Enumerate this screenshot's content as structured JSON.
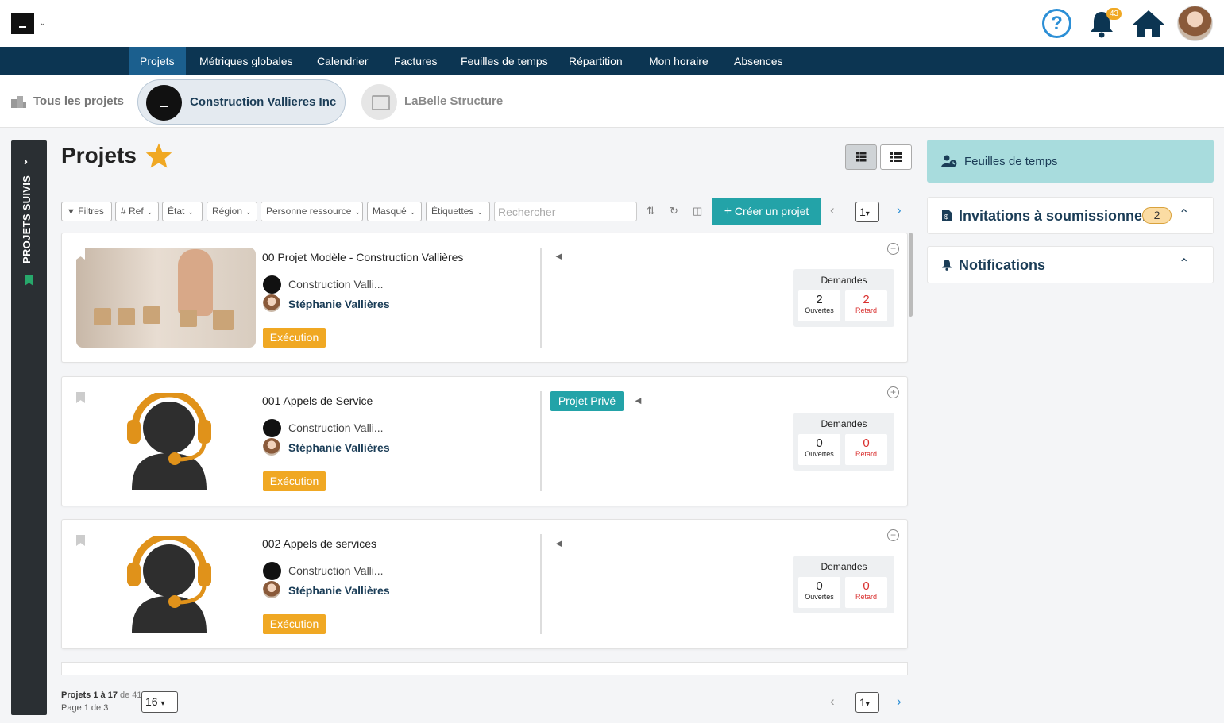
{
  "header": {
    "notification_count": "43",
    "help_symbol": "?"
  },
  "nav": {
    "items": [
      "Projets",
      "Métriques globales",
      "Calendrier",
      "Factures",
      "Feuilles de temps",
      "Répartition",
      "Mon horaire",
      "Absences"
    ],
    "active": "Projets"
  },
  "project_strip": {
    "all_projects": "Tous les projets",
    "active_company": "Construction Vallieres Inc",
    "other_company": "LaBelle Structure"
  },
  "sidebar": {
    "label": "PROJETS SUIVIS",
    "toggle": "›"
  },
  "main": {
    "title": "Projets",
    "filters": {
      "filtres": "Filtres",
      "ref": "# Ref",
      "etat": "État",
      "region": "Région",
      "personne": "Personne ressource",
      "masque": "Masqué",
      "etiquettes": "Étiquettes"
    },
    "search_placeholder": "Rechercher",
    "create_button": "Créer un projet",
    "page_current": "1",
    "projects": [
      {
        "title": "00 Projet Modèle - Construction Vallières",
        "org": "Construction Valli...",
        "person": "Stéphanie Vallières",
        "status": "Exécution",
        "private": "",
        "requests_label": "Demandes",
        "open_count": "2",
        "open_label": "Ouvertes",
        "late_count": "2",
        "late_label": "Retard",
        "toggle": "−"
      },
      {
        "title": "001 Appels de Service",
        "org": "Construction Valli...",
        "person": "Stéphanie Vallières",
        "status": "Exécution",
        "private": "Projet Privé",
        "requests_label": "Demandes",
        "open_count": "0",
        "open_label": "Ouvertes",
        "late_count": "0",
        "late_label": "Retard",
        "toggle": "+"
      },
      {
        "title": "002 Appels de services",
        "org": "Construction Valli...",
        "person": "Stéphanie Vallières",
        "status": "Exécution",
        "private": "",
        "requests_label": "Demandes",
        "open_count": "0",
        "open_label": "Ouvertes",
        "late_count": "0",
        "late_label": "Retard",
        "toggle": "−"
      }
    ],
    "footer": {
      "count_bold": "Projets 1 à 17",
      "count_rest": " de 41",
      "page_info": "Page 1 de 3",
      "per_page": "16",
      "page_current": "1"
    }
  },
  "right_panel": {
    "timesheets": "Feuilles de temps",
    "invitations": "Invitations à soumissionner",
    "invitations_count": "2",
    "notifications": "Notifications"
  },
  "colors": {
    "nav_bg": "#0c3552",
    "nav_active": "#1b5f8e",
    "accent_teal": "#23a3a8",
    "status_orange": "#f0a823",
    "late_red": "#d9302f",
    "text_navy": "#1b3d57"
  }
}
